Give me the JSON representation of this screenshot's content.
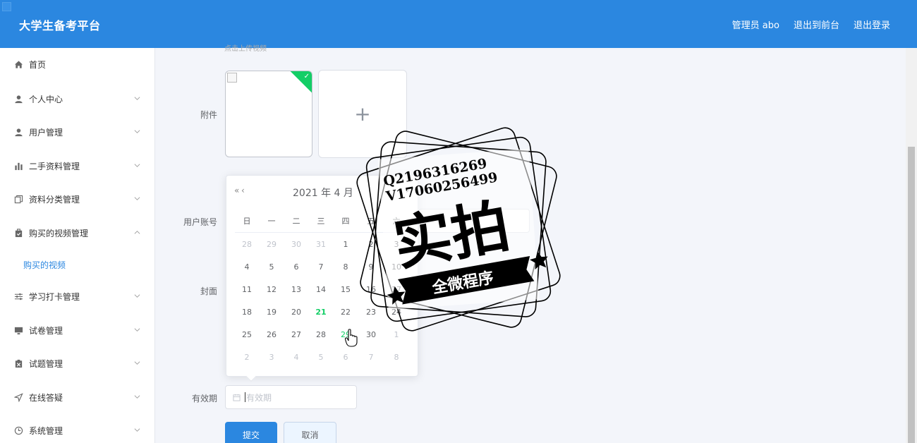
{
  "header": {
    "title": "大学生备考平台",
    "links": [
      "管理员 abo",
      "退出到前台",
      "退出登录"
    ]
  },
  "sidebar": {
    "items": [
      {
        "label": "首页",
        "icon": "home-icon"
      },
      {
        "label": "个人中心",
        "icon": "user-icon"
      },
      {
        "label": "用户管理",
        "icon": "user-manage-icon"
      },
      {
        "label": "二手资料管理",
        "icon": "bar-chart-icon"
      },
      {
        "label": "资料分类管理",
        "icon": "copy-icon"
      },
      {
        "label": "购买的视频管理",
        "icon": "goods-icon"
      },
      {
        "label": "购买的视频",
        "icon": ""
      },
      {
        "label": "学习打卡管理",
        "icon": "sliders-icon"
      },
      {
        "label": "试卷管理",
        "icon": "monitor-icon"
      },
      {
        "label": "试题管理",
        "icon": "clipboard-icon"
      },
      {
        "label": "在线答疑",
        "icon": "send-icon"
      },
      {
        "label": "系统管理",
        "icon": "clock-icon"
      }
    ]
  },
  "form": {
    "hint": "点击上传视频",
    "attachment_label": "附件",
    "account_label": "用户账号",
    "cover_label": "封面",
    "validity_label": "有效期",
    "validity_placeholder": "有效期",
    "submit_label": "提交",
    "cancel_label": "取消"
  },
  "datepicker": {
    "title": "2021 年  4 月",
    "prev_year": "«",
    "prev_month": "‹",
    "next": "›",
    "weekdays": [
      "日",
      "一",
      "二",
      "三",
      "四",
      "五",
      "六"
    ],
    "weeks": [
      [
        [
          "28",
          "other"
        ],
        [
          "29",
          "other"
        ],
        [
          "30",
          "other"
        ],
        [
          "31",
          "other"
        ],
        [
          "1",
          ""
        ],
        [
          "2",
          ""
        ],
        [
          "3",
          ""
        ]
      ],
      [
        [
          "4",
          ""
        ],
        [
          "5",
          ""
        ],
        [
          "6",
          ""
        ],
        [
          "7",
          ""
        ],
        [
          "8",
          ""
        ],
        [
          "9",
          ""
        ],
        [
          "10",
          ""
        ]
      ],
      [
        [
          "11",
          ""
        ],
        [
          "12",
          ""
        ],
        [
          "13",
          ""
        ],
        [
          "14",
          ""
        ],
        [
          "15",
          ""
        ],
        [
          "16",
          ""
        ],
        [
          "17",
          ""
        ]
      ],
      [
        [
          "18",
          ""
        ],
        [
          "19",
          ""
        ],
        [
          "20",
          ""
        ],
        [
          "21",
          "today"
        ],
        [
          "22",
          ""
        ],
        [
          "23",
          ""
        ],
        [
          "24",
          ""
        ]
      ],
      [
        [
          "25",
          ""
        ],
        [
          "26",
          ""
        ],
        [
          "27",
          ""
        ],
        [
          "28",
          ""
        ],
        [
          "29",
          "hover"
        ],
        [
          "30",
          ""
        ],
        [
          "1",
          "other"
        ]
      ],
      [
        [
          "2",
          "other"
        ],
        [
          "3",
          "other"
        ],
        [
          "4",
          "other"
        ],
        [
          "5",
          "other"
        ],
        [
          "6",
          "other"
        ],
        [
          "7",
          "other"
        ],
        [
          "8",
          "other"
        ]
      ]
    ]
  },
  "watermark": {
    "line1": "Q2196316269",
    "line2": "V17060256499",
    "main": "实拍",
    "banner": "全微程序"
  },
  "colors": {
    "primary": "#2b87e0",
    "success": "#13ce66"
  }
}
